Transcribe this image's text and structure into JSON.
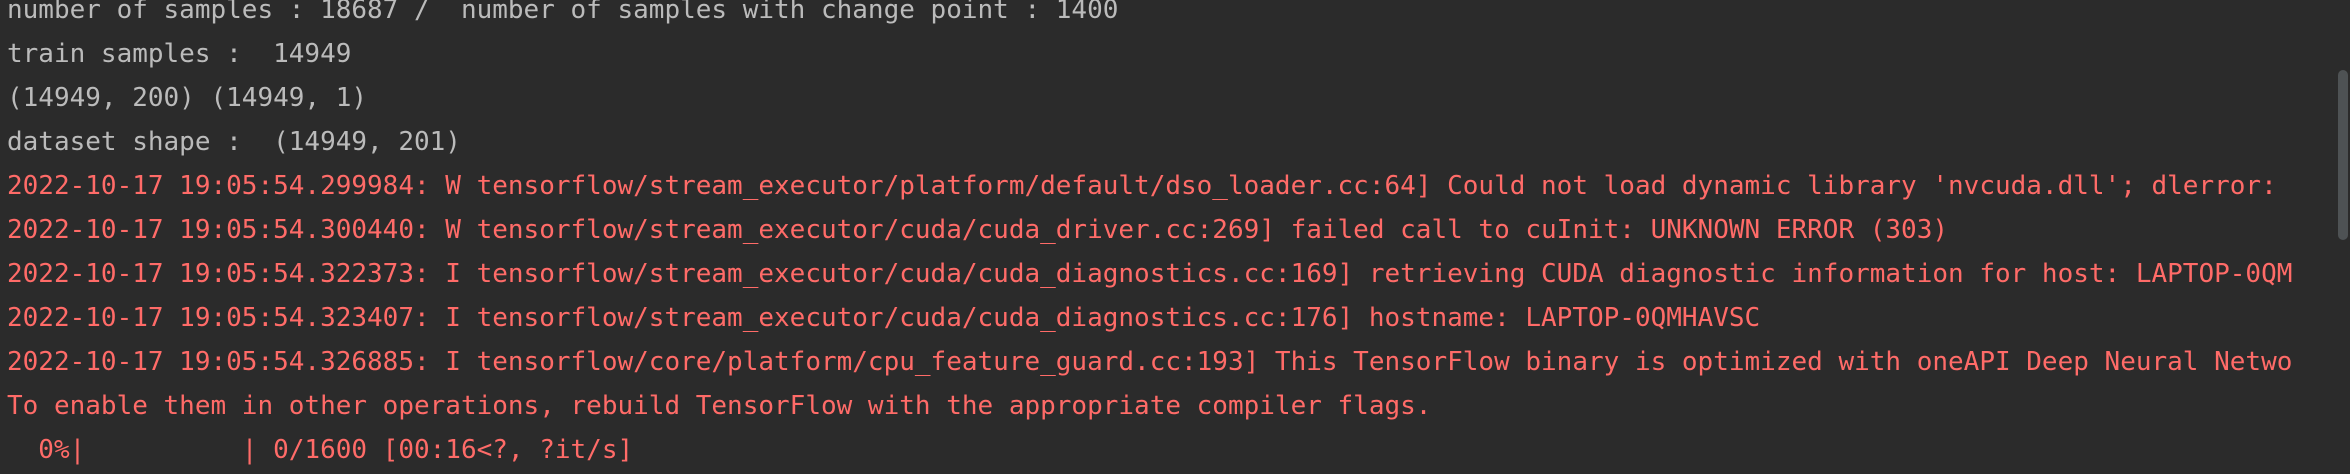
{
  "console": {
    "lines": [
      {
        "type": "stdout",
        "text": "number of samples : 18687 /  number of samples with change point : 1400"
      },
      {
        "type": "stdout",
        "text": "train samples :  14949"
      },
      {
        "type": "stdout",
        "text": "(14949, 200) (14949, 1)"
      },
      {
        "type": "stdout",
        "text": "dataset shape :  (14949, 201)"
      },
      {
        "type": "stderr",
        "text": "2022-10-17 19:05:54.299984: W tensorflow/stream_executor/platform/default/dso_loader.cc:64] Could not load dynamic library 'nvcuda.dll'; dlerror:"
      },
      {
        "type": "stderr",
        "text": "2022-10-17 19:05:54.300440: W tensorflow/stream_executor/cuda/cuda_driver.cc:269] failed call to cuInit: UNKNOWN ERROR (303)"
      },
      {
        "type": "stderr",
        "text": "2022-10-17 19:05:54.322373: I tensorflow/stream_executor/cuda/cuda_diagnostics.cc:169] retrieving CUDA diagnostic information for host: LAPTOP-0QM"
      },
      {
        "type": "stderr",
        "text": "2022-10-17 19:05:54.323407: I tensorflow/stream_executor/cuda/cuda_diagnostics.cc:176] hostname: LAPTOP-0QMHAVSC"
      },
      {
        "type": "stderr",
        "text": "2022-10-17 19:05:54.326885: I tensorflow/core/platform/cpu_feature_guard.cc:193] This TensorFlow binary is optimized with oneAPI Deep Neural Netwo"
      },
      {
        "type": "stderr",
        "text": "To enable them in other operations, rebuild TensorFlow with the appropriate compiler flags."
      },
      {
        "type": "progress",
        "text": "  0%|          | 0/1600 [00:16<?, ?it/s]"
      }
    ]
  },
  "progress": {
    "percent": 0,
    "done": 0,
    "total": 1600
  },
  "colors": {
    "background": "#2b2b2b",
    "stdout": "#bbbbbb",
    "stderr": "#ff6b68",
    "scrollbar_thumb": "#4e5254"
  }
}
